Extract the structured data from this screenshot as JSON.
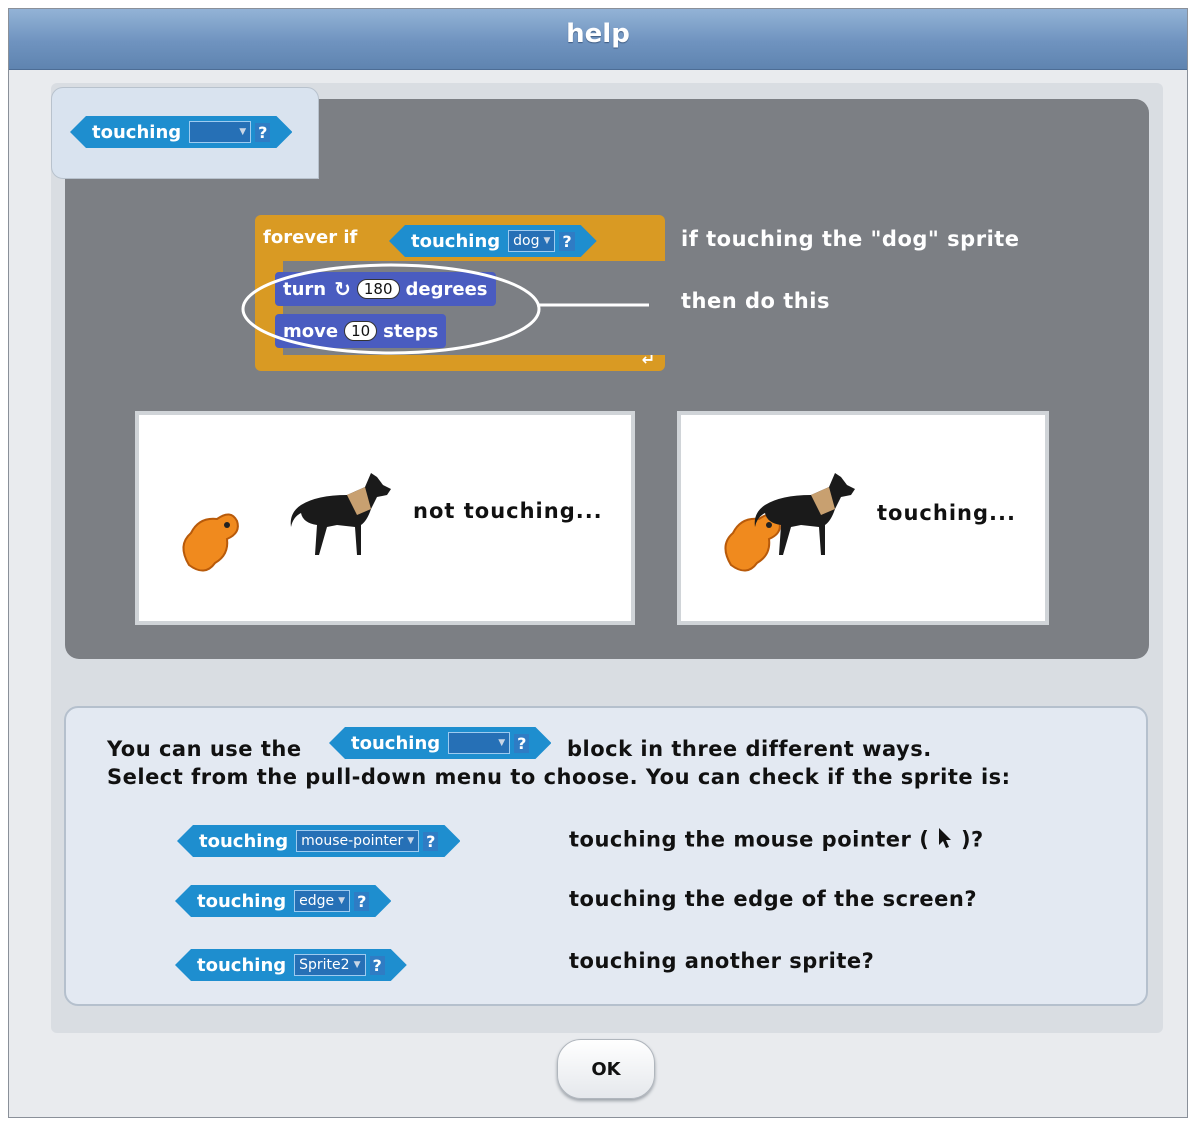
{
  "window": {
    "title": "help"
  },
  "palette_block": {
    "label": "touching",
    "dropdown": "",
    "qmark": "?"
  },
  "script": {
    "forever_if": "forever if",
    "condition": {
      "label": "touching",
      "dropdown": "dog",
      "qmark": "?"
    },
    "turn": {
      "label": "turn",
      "value": "180",
      "unit": "degrees"
    },
    "move": {
      "label": "move",
      "value": "10",
      "unit": "steps"
    },
    "annotation_1": "if touching the \"dog\" sprite",
    "annotation_2": "then do this"
  },
  "scenes": [
    {
      "caption": "not touching..."
    },
    {
      "caption": "touching..."
    }
  ],
  "explanation": {
    "line1_prefix": "You can use the",
    "inline_block": {
      "label": "touching",
      "dropdown": "",
      "qmark": "?"
    },
    "line1_suffix": "block in three different ways.",
    "line2": "Select from the pull-down menu to choose.  You can check if the sprite is:",
    "options": [
      {
        "label": "touching",
        "dropdown": "mouse-pointer",
        "qmark": "?",
        "desc": "touching the mouse pointer (",
        "desc_suffix": ")?"
      },
      {
        "label": "touching",
        "dropdown": "edge",
        "qmark": "?",
        "desc": "touching the edge of the screen?"
      },
      {
        "label": "touching",
        "dropdown": "Sprite2",
        "qmark": "?",
        "desc": "touching another sprite?"
      }
    ]
  },
  "ok_button": "OK",
  "colors": {
    "sensing_block": "#1e8ecf",
    "control_block": "#d99a23",
    "motion_block": "#4a5cc0",
    "title_bar": "#6f93bf",
    "sprite_cat": "#f08a1e"
  }
}
